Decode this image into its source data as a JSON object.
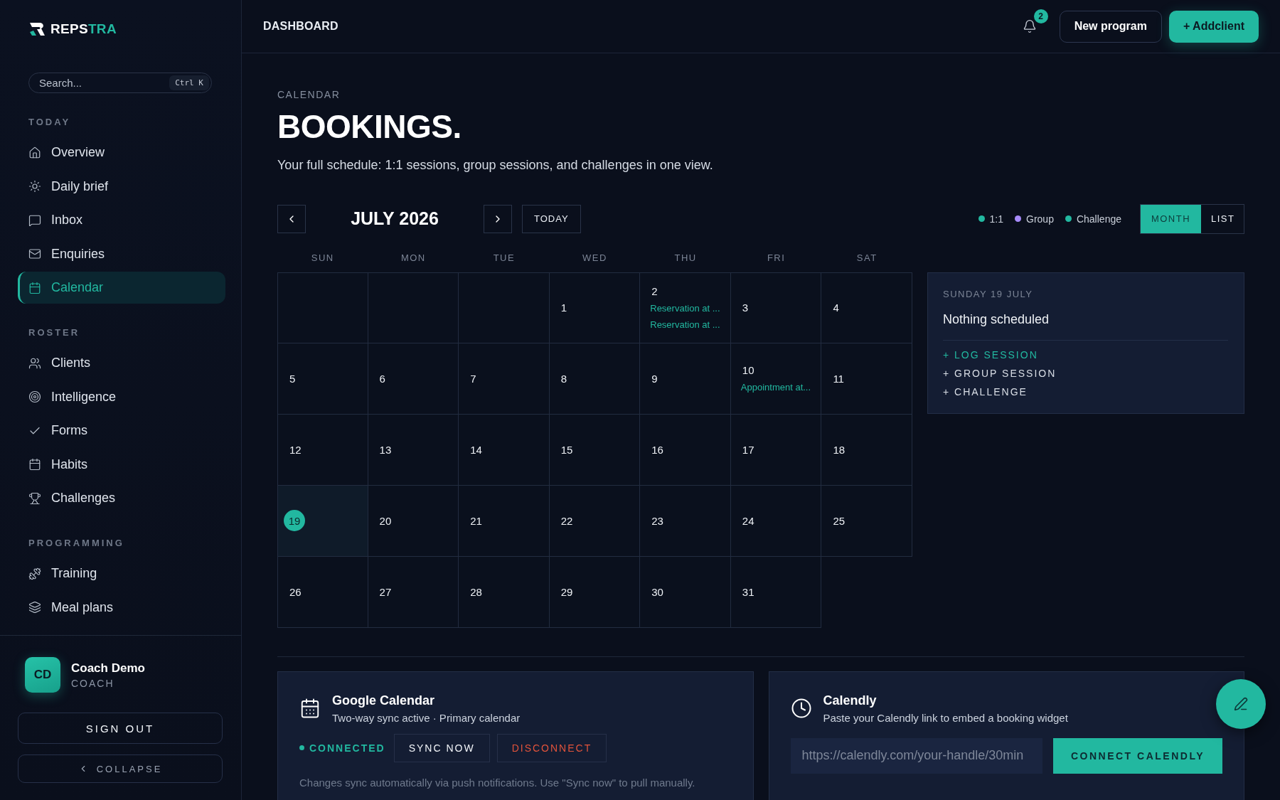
{
  "brand": {
    "lead": "REPS",
    "accent": "TRA"
  },
  "search": {
    "placeholder": "Search...",
    "shortcut": "Ctrl K"
  },
  "sidebar": {
    "sections": [
      {
        "title": "TODAY",
        "items": [
          {
            "label": "Overview",
            "selected": false
          },
          {
            "label": "Daily brief",
            "selected": false
          },
          {
            "label": "Inbox",
            "selected": false
          },
          {
            "label": "Enquiries",
            "selected": false
          },
          {
            "label": "Calendar",
            "selected": true
          }
        ]
      },
      {
        "title": "ROSTER",
        "items": [
          {
            "label": "Clients",
            "selected": false
          },
          {
            "label": "Intelligence",
            "selected": false
          },
          {
            "label": "Forms",
            "selected": false
          },
          {
            "label": "Habits",
            "selected": false
          },
          {
            "label": "Challenges",
            "selected": false
          }
        ]
      },
      {
        "title": "PROGRAMMING",
        "items": [
          {
            "label": "Training",
            "selected": false
          },
          {
            "label": "Meal plans",
            "selected": false
          }
        ]
      }
    ]
  },
  "profile": {
    "initials": "CD",
    "name": "Coach Demo",
    "role": "COACH"
  },
  "sidebar_buttons": {
    "sign_out": "SIGN OUT",
    "collapse": "COLLAPSE"
  },
  "header": {
    "title": "DASHBOARD",
    "notification_count": "2",
    "buttons": [
      {
        "label": "New program",
        "kind": "outline"
      },
      {
        "label": "+ Addclient",
        "kind": "primary"
      }
    ]
  },
  "page": {
    "eyebrow": "CALENDAR",
    "title": "BOOKINGS.",
    "subtitle": "Your full schedule: 1:1 sessions, group sessions, and challenges in one view."
  },
  "toolbar": {
    "month": "JULY 2026",
    "today": "TODAY",
    "legend": [
      {
        "label": "1:1",
        "color": "#22b8a0"
      },
      {
        "label": "Group",
        "color": "#a78bfa"
      },
      {
        "label": "Challenge",
        "color": "#22b8a0"
      }
    ],
    "views": [
      {
        "label": "MONTH",
        "selected": true
      },
      {
        "label": "LIST",
        "selected": false
      }
    ]
  },
  "calendar": {
    "weekdays": [
      "SUN",
      "MON",
      "TUE",
      "WED",
      "THU",
      "FRI",
      "SAT"
    ],
    "cells": [
      {
        "kind": "blank"
      },
      {
        "kind": "blank"
      },
      {
        "kind": "blank"
      },
      {
        "kind": "day",
        "day": "1",
        "selected": false
      },
      {
        "kind": "day",
        "day": "2",
        "selected": false,
        "events": [
          "Reservation at ...",
          "Reservation at ..."
        ]
      },
      {
        "kind": "day",
        "day": "3",
        "selected": false
      },
      {
        "kind": "day",
        "day": "4",
        "selected": false
      },
      {
        "kind": "day",
        "day": "5",
        "selected": false
      },
      {
        "kind": "day",
        "day": "6",
        "selected": false
      },
      {
        "kind": "day",
        "day": "7",
        "selected": false
      },
      {
        "kind": "day",
        "day": "8",
        "selected": false
      },
      {
        "kind": "day",
        "day": "9",
        "selected": false
      },
      {
        "kind": "day",
        "day": "10",
        "selected": false,
        "events": [
          "Appointment at..."
        ]
      },
      {
        "kind": "day",
        "day": "11",
        "selected": false
      },
      {
        "kind": "day",
        "day": "12",
        "selected": false
      },
      {
        "kind": "day",
        "day": "13",
        "selected": false
      },
      {
        "kind": "day",
        "day": "14",
        "selected": false
      },
      {
        "kind": "day",
        "day": "15",
        "selected": false
      },
      {
        "kind": "day",
        "day": "16",
        "selected": false
      },
      {
        "kind": "day",
        "day": "17",
        "selected": false
      },
      {
        "kind": "day",
        "day": "18",
        "selected": false
      },
      {
        "kind": "day",
        "day": "19",
        "selected": true
      },
      {
        "kind": "day",
        "day": "20",
        "selected": false
      },
      {
        "kind": "day",
        "day": "21",
        "selected": false
      },
      {
        "kind": "day",
        "day": "22",
        "selected": false
      },
      {
        "kind": "day",
        "day": "23",
        "selected": false
      },
      {
        "kind": "day",
        "day": "24",
        "selected": false
      },
      {
        "kind": "day",
        "day": "25",
        "selected": false
      },
      {
        "kind": "day",
        "day": "26",
        "selected": false
      },
      {
        "kind": "day",
        "day": "27",
        "selected": false
      },
      {
        "kind": "day",
        "day": "28",
        "selected": false
      },
      {
        "kind": "day",
        "day": "29",
        "selected": false
      },
      {
        "kind": "day",
        "day": "30",
        "selected": false
      },
      {
        "kind": "day",
        "day": "31",
        "selected": false
      }
    ]
  },
  "day_panel": {
    "date": "SUNDAY 19 JULY",
    "status": "Nothing scheduled",
    "actions": [
      {
        "label": "+ LOG SESSION",
        "kind": "primary"
      },
      {
        "label": "+ GROUP SESSION",
        "kind": "default"
      },
      {
        "label": "+ CHALLENGE",
        "kind": "default"
      }
    ]
  },
  "integrations": {
    "google": {
      "title": "Google Calendar",
      "subtitle": "Two-way sync active · Primary calendar",
      "status": "CONNECTED",
      "buttons": [
        {
          "label": "SYNC NOW",
          "kind": "default"
        },
        {
          "label": "DISCONNECT",
          "kind": "danger"
        }
      ],
      "note": "Changes sync automatically via push notifications. Use \"Sync now\" to pull manually."
    },
    "calendly": {
      "title": "Calendly",
      "subtitle": "Paste your Calendly link to embed a booking widget",
      "placeholder": "https://calendly.com/your-handle/30min",
      "button": "CONNECT CALENDLY"
    }
  }
}
